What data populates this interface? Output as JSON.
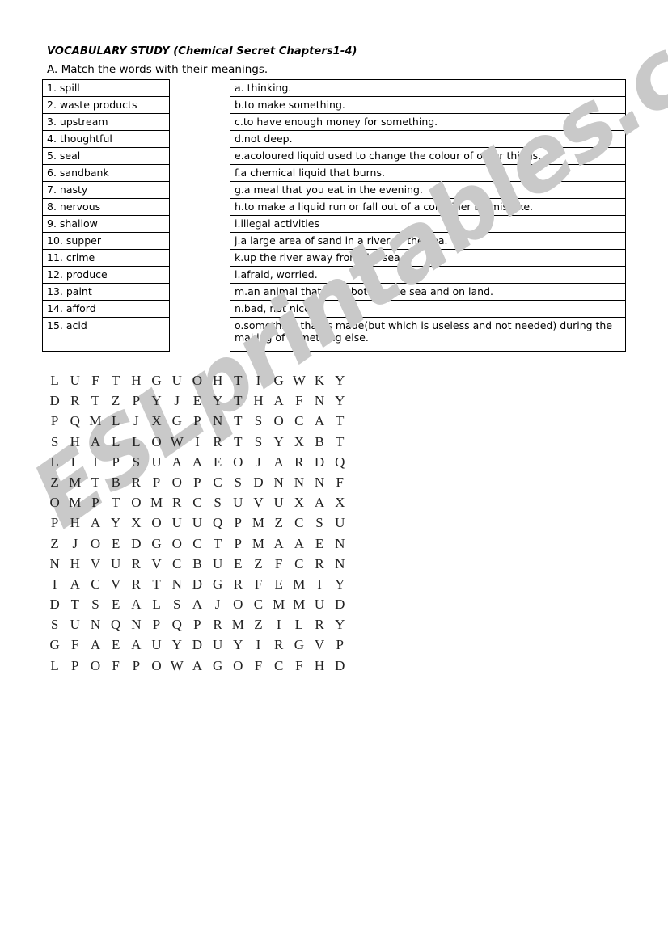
{
  "document": {
    "title": "VOCABULARY STUDY (Chemical Secret Chapters1-4)",
    "instruction": "A. Match the words with their meanings."
  },
  "watermark": {
    "text": "ESLprintables.com",
    "color": "#c9c9c9"
  },
  "matching": {
    "words": [
      {
        "label": "1. spill"
      },
      {
        "label": "2. waste products"
      },
      {
        "label": "3. upstream"
      },
      {
        "label": "4. thoughtful"
      },
      {
        "label": "5. seal"
      },
      {
        "label": "6. sandbank"
      },
      {
        "label": "7. nasty"
      },
      {
        "label": "8. nervous"
      },
      {
        "label": "9. shallow"
      },
      {
        "label": "10. supper"
      },
      {
        "label": "11. crime"
      },
      {
        "label": "12. produce"
      },
      {
        "label": "13. paint"
      },
      {
        "label": "14. afford"
      },
      {
        "label": "15. acid"
      }
    ],
    "definitions": [
      {
        "label": "a. thinking."
      },
      {
        "label": "b.to make something."
      },
      {
        "label": "c.to have enough money for something."
      },
      {
        "label": "d.not deep."
      },
      {
        "label": "e.acoloured liquid used to change the colour of other things."
      },
      {
        "label": "f.a chemical liquid that burns."
      },
      {
        "label": "g.a meal that you eat in the evening."
      },
      {
        "label": "h.to make a liquid run or fall out of a container by mistake."
      },
      {
        "label": "i.illegal activities"
      },
      {
        "label": "j.a large area of sand in a river or the sea."
      },
      {
        "label": "k.up the river away from the sea."
      },
      {
        "label": "l.afraid, worried."
      },
      {
        "label": "m.an animal that lives both in the sea and on land."
      },
      {
        "label": "n.bad, not nice."
      },
      {
        "label": "o.something that is made(but which is useless and not needed) during the making of something else."
      }
    ]
  },
  "wordsearch": {
    "rows": [
      [
        "L",
        "U",
        "F",
        "T",
        "H",
        "G",
        "U",
        "O",
        "H",
        "T",
        "I",
        "G",
        "W",
        "K",
        "Y"
      ],
      [
        "D",
        "R",
        "T",
        "Z",
        "P",
        "Y",
        "J",
        "E",
        "Y",
        "T",
        "H",
        "A",
        "F",
        "N",
        "Y"
      ],
      [
        "P",
        "Q",
        "M",
        "L",
        "J",
        "X",
        "G",
        "P",
        "N",
        "T",
        "S",
        "O",
        "C",
        "A",
        "T"
      ],
      [
        "S",
        "H",
        "A",
        "L",
        "L",
        "O",
        "W",
        "I",
        "R",
        "T",
        "S",
        "Y",
        "X",
        "B",
        "T"
      ],
      [
        "L",
        "L",
        "I",
        "P",
        "S",
        "U",
        "A",
        "A",
        "E",
        "O",
        "J",
        "A",
        "R",
        "D",
        "Q"
      ],
      [
        "Z",
        "M",
        "T",
        "B",
        "R",
        "P",
        "O",
        "P",
        "C",
        "S",
        "D",
        "N",
        "N",
        "N",
        "F"
      ],
      [
        "O",
        "M",
        "P",
        "T",
        "O",
        "M",
        "R",
        "C",
        "S",
        "U",
        "V",
        "U",
        "X",
        "A",
        "X"
      ],
      [
        "P",
        "H",
        "A",
        "Y",
        "X",
        "O",
        "U",
        "U",
        "Q",
        "P",
        "M",
        "Z",
        "C",
        "S",
        "U"
      ],
      [
        "Z",
        "J",
        "O",
        "E",
        "D",
        "G",
        "O",
        "C",
        "T",
        "P",
        "M",
        "A",
        "A",
        "E",
        "N"
      ],
      [
        "N",
        "H",
        "V",
        "U",
        "R",
        "V",
        "C",
        "B",
        "U",
        "E",
        "Z",
        "F",
        "C",
        "R",
        "N"
      ],
      [
        "I",
        "A",
        "C",
        "V",
        "R",
        "T",
        "N",
        "D",
        "G",
        "R",
        "F",
        "E",
        "M",
        "I",
        "Y"
      ],
      [
        "D",
        "T",
        "S",
        "E",
        "A",
        "L",
        "S",
        "A",
        "J",
        "O",
        "C",
        "M",
        "M",
        "U",
        "D"
      ],
      [
        "S",
        "U",
        "N",
        "Q",
        "N",
        "P",
        "Q",
        "P",
        "R",
        "M",
        "Z",
        "I",
        "L",
        "R",
        "Y"
      ],
      [
        "G",
        "F",
        "A",
        "E",
        "A",
        "U",
        "Y",
        "D",
        "U",
        "Y",
        "I",
        "R",
        "G",
        "V",
        "P"
      ],
      [
        "L",
        "P",
        "O",
        "F",
        "P",
        "O",
        "W",
        "A",
        "G",
        "O",
        "F",
        "C",
        "F",
        "H",
        "D"
      ]
    ]
  }
}
